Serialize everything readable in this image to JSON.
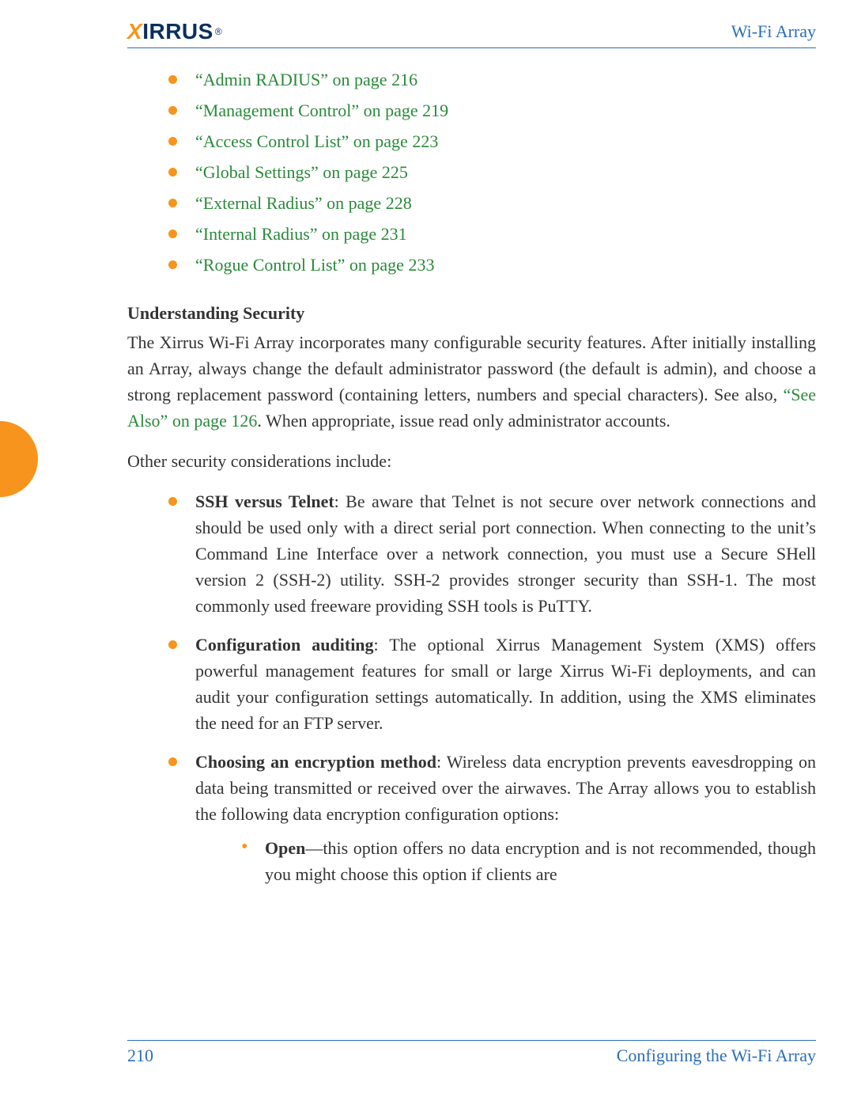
{
  "header": {
    "logo_text": "XIRRUS",
    "doc_title": "Wi-Fi Array"
  },
  "links": [
    "“Admin RADIUS” on page 216",
    "“Management Control” on page 219",
    "“Access Control List” on page 223",
    "“Global Settings” on page 225",
    "“External Radius” on page 228",
    "“Internal Radius” on page 231",
    "“Rogue Control List” on page 233"
  ],
  "section": {
    "heading": "Understanding Security",
    "para1_pre": "The Xirrus Wi-Fi Array incorporates many configurable security features. After initially installing an Array, always change the default administrator password (the default is admin), and choose a strong replacement password (containing letters, numbers and special characters). See also, ",
    "para1_link": "“See Also” on page 126",
    "para1_post": ". When appropriate, issue read only administrator accounts.",
    "para2": "Other security considerations include:"
  },
  "considerations": [
    {
      "lead": "SSH versus Telnet",
      "rest": ": Be aware that Telnet is not secure over network connections and should be used only with a direct serial port connection. When connecting to the unit’s Command Line Interface over a network connection, you must use a Secure SHell version 2 (SSH-2) utility. SSH-2 provides stronger security than SSH-1. The most commonly used freeware providing SSH tools is PuTTY."
    },
    {
      "lead": "Configuration auditing",
      "rest": ": The optional Xirrus Management System (XMS) offers powerful management features for small or large Xirrus Wi-Fi deployments, and can audit your configuration settings automatically. In addition, using the XMS eliminates the need for an FTP server."
    },
    {
      "lead": "Choosing an encryption method",
      "rest": ": Wireless data encryption prevents eavesdropping on data being transmitted or received over the airwaves. The Array allows you to establish the following data encryption configuration options:"
    }
  ],
  "encryption_options": [
    {
      "lead": "Open",
      "rest": "—this option offers no data encryption and is not recommended, though you might choose this option if clients are"
    }
  ],
  "footer": {
    "page_number": "210",
    "section_title": "Configuring the Wi-Fi Array"
  }
}
